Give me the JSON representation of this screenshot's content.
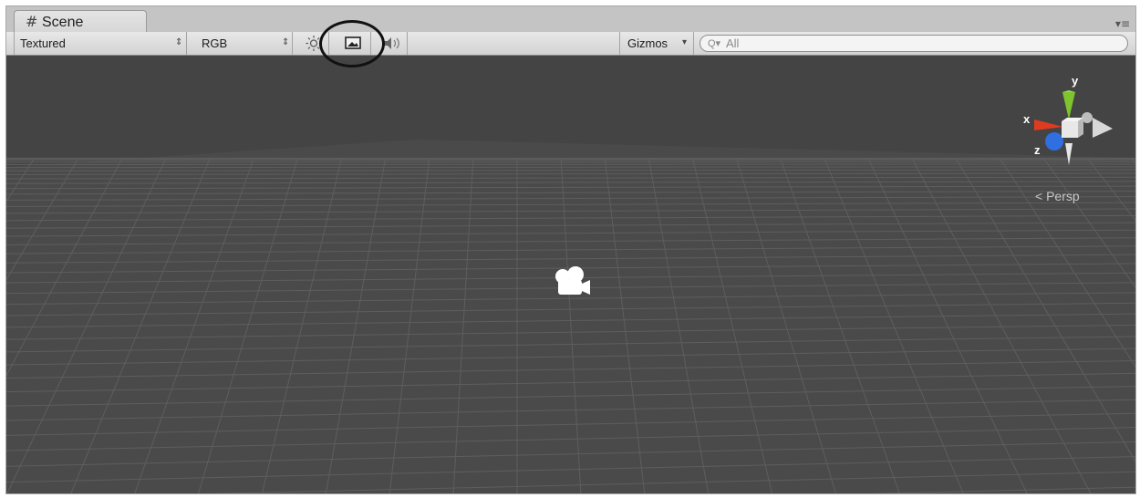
{
  "tab": {
    "icon": "#",
    "title": "Scene",
    "menu_icon": "▾≡"
  },
  "toolbar": {
    "draw_mode": "Textured",
    "render_mode": "RGB",
    "lighting_icon": "sun-icon",
    "scene_fx_icon": "image-icon",
    "audio_icon": "speaker-icon",
    "gizmos_label": "Gizmos",
    "search_value": "All",
    "search_prefix": "Q▾"
  },
  "viewport": {
    "projection_label": "Persp",
    "axis_x": "x",
    "axis_y": "y",
    "axis_z": "z",
    "background_color": "#474747",
    "grid_color": "#5e5e5e"
  },
  "colors": {
    "x_axis": "#e03b1f",
    "y_axis": "#7fc42e",
    "z_axis": "#2f6fe0"
  }
}
